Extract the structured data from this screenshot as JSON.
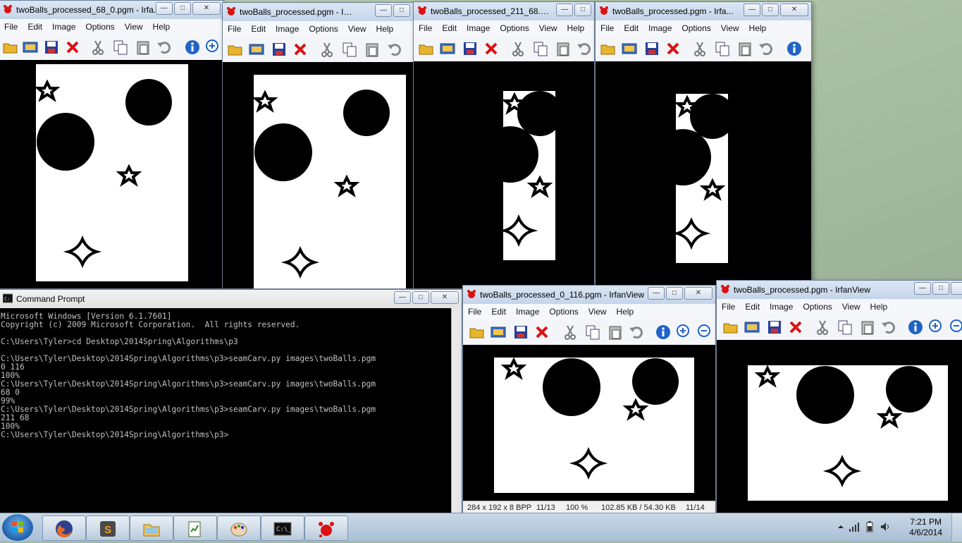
{
  "menu": [
    "File",
    "Edit",
    "Image",
    "Options",
    "View",
    "Help"
  ],
  "windows": {
    "w1": {
      "title": "twoBalls_processed_68_0.pgm - Irfa..."
    },
    "w2": {
      "title": "twoBalls_processed.pgm - Irfa..."
    },
    "w3": {
      "title": "twoBalls_processed_211_68.pgm - I..."
    },
    "w4": {
      "title": "twoBalls_processed.pgm - Irfa..."
    },
    "w5": {
      "title": "twoBalls_processed_0_116.pgm - IrfanView",
      "status": [
        "284 x 192 x 8 BPP",
        "11/13",
        "100 %",
        "102.85 KB / 54.30 KB",
        "11/14"
      ]
    },
    "w6": {
      "title": "twoBalls_processed.pgm - IrfanView"
    }
  },
  "cmd": {
    "title": "Command Prompt",
    "lines": [
      "Microsoft Windows [Version 6.1.7601]",
      "Copyright (c) 2009 Microsoft Corporation.  All rights reserved.",
      "",
      "C:\\Users\\Tyler>cd Desktop\\2014Spring\\Algorithms\\p3",
      "",
      "C:\\Users\\Tyler\\Desktop\\2014Spring\\Algorithms\\p3>seamCarv.py images\\twoBalls.pgm",
      "0 116",
      "100%",
      "C:\\Users\\Tyler\\Desktop\\2014Spring\\Algorithms\\p3>seamCarv.py images\\twoBalls.pgm",
      "68 0",
      "99%",
      "C:\\Users\\Tyler\\Desktop\\2014Spring\\Algorithms\\p3>seamCarv.py images\\twoBalls.pgm",
      "211 68",
      "100%",
      "C:\\Users\\Tyler\\Desktop\\2014Spring\\Algorithms\\p3>"
    ]
  },
  "clock": {
    "time": "7:21 PM",
    "date": "4/6/2014"
  },
  "taskbar_items": [
    "firefox-icon",
    "sublime-text-icon",
    "explorer-icon",
    "notepad-icon",
    "paint-icon",
    "command-prompt-icon",
    "irfanview-icon"
  ]
}
